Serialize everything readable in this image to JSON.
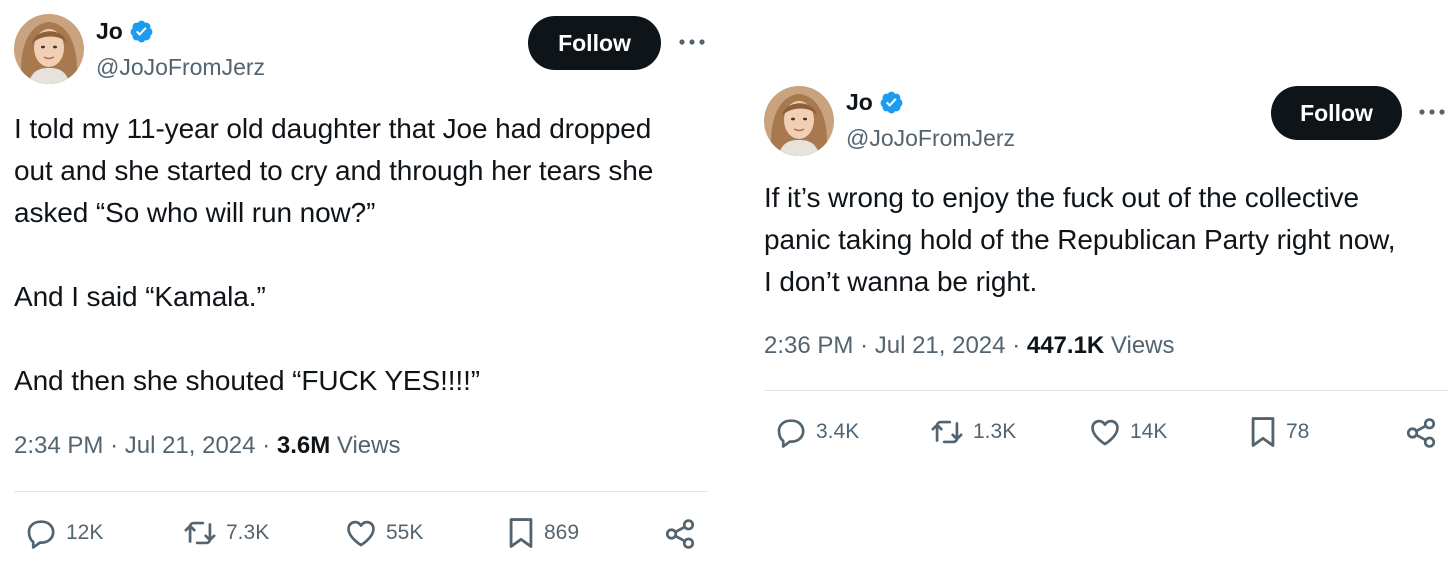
{
  "tweets": [
    {
      "author": {
        "name": "Jo",
        "handle": "@JoJoFromJerz",
        "verified_icon": "verified-badge-icon"
      },
      "follow_label": "Follow",
      "lines": [
        "I told my 11-year old daughter that Joe had dropped",
        "out and she started to cry and through her tears she",
        "asked “So who will run now?”",
        "",
        "And I said “Kamala.”",
        "",
        "And then she shouted “FUCK YES!!!!”"
      ],
      "time": "2:34 PM",
      "date": "Jul 21, 2024",
      "views_count": "3.6M",
      "views_label": "Views",
      "actions": {
        "replies": "12K",
        "reposts": "7.3K",
        "likes": "55K",
        "bookmarks": "869"
      }
    },
    {
      "author": {
        "name": "Jo",
        "handle": "@JoJoFromJerz",
        "verified_icon": "verified-badge-icon"
      },
      "follow_label": "Follow",
      "lines": [
        "If it’s wrong to enjoy the fuck out of the collective",
        "panic taking hold of the Republican Party right now,",
        "I don’t wanna be right."
      ],
      "time": "2:36 PM",
      "date": "Jul 21, 2024",
      "views_count": "447.1K",
      "views_label": "Views",
      "actions": {
        "replies": "3.4K",
        "reposts": "1.3K",
        "likes": "14K",
        "bookmarks": "78"
      }
    }
  ],
  "colors": {
    "text": "#0f1419",
    "secondary": "#536471",
    "verified": "#1d9bf0",
    "follow_bg": "#0f1419",
    "divider": "#e1e6ea"
  }
}
